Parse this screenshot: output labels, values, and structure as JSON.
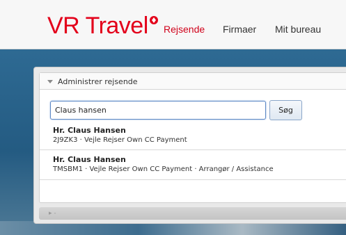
{
  "header": {
    "logo_text": "VR Travel",
    "nav": [
      {
        "label": "Rejsende",
        "active": true
      },
      {
        "label": "Firmaer",
        "active": false
      },
      {
        "label": "Mit bureau",
        "active": false
      }
    ]
  },
  "panel": {
    "title": "Administrer rejsende",
    "search": {
      "value": "Claus hansen",
      "button_label": "Søg"
    },
    "results": [
      {
        "name": "Hr. Claus Hansen",
        "meta": "2J9ZK3 · Vejle Rejser Own CC Payment"
      },
      {
        "name": "Hr. Claus Hansen",
        "meta": "TMSBM1 · Vejle Rejser Own CC Payment · Arrangør / Assistance"
      }
    ]
  },
  "colors": {
    "brand": "#e3001b",
    "accent": "#5b87c5",
    "band": "#2b5f86"
  }
}
